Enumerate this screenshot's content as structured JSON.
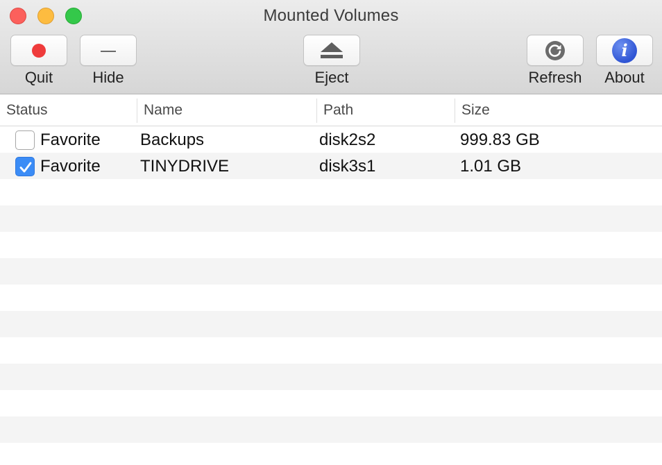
{
  "window": {
    "title": "Mounted Volumes"
  },
  "toolbar": {
    "quit": {
      "label": "Quit",
      "icon": "record-dot-icon"
    },
    "hide": {
      "label": "Hide",
      "icon": "minus-icon"
    },
    "eject": {
      "label": "Eject",
      "icon": "eject-icon"
    },
    "refresh": {
      "label": "Refresh",
      "icon": "refresh-icon"
    },
    "about": {
      "label": "About",
      "icon": "info-icon",
      "glyph": "i"
    }
  },
  "table": {
    "columns": [
      "Status",
      "Name",
      "Path",
      "Size"
    ],
    "rows": [
      {
        "checked": false,
        "status": "Favorite",
        "name": "Backups",
        "path": "disk2s2",
        "size": "999.83 GB"
      },
      {
        "checked": true,
        "status": "Favorite",
        "name": "TINYDRIVE",
        "path": "disk3s1",
        "size": "1.01 GB"
      }
    ]
  },
  "colors": {
    "checkbox_accent": "#3b8cf6",
    "quit_dot": "#ef3b3b",
    "about_icon": "#2f55d4",
    "close": "#fc605c",
    "minimize": "#fdbc40",
    "zoom": "#34c84a"
  }
}
